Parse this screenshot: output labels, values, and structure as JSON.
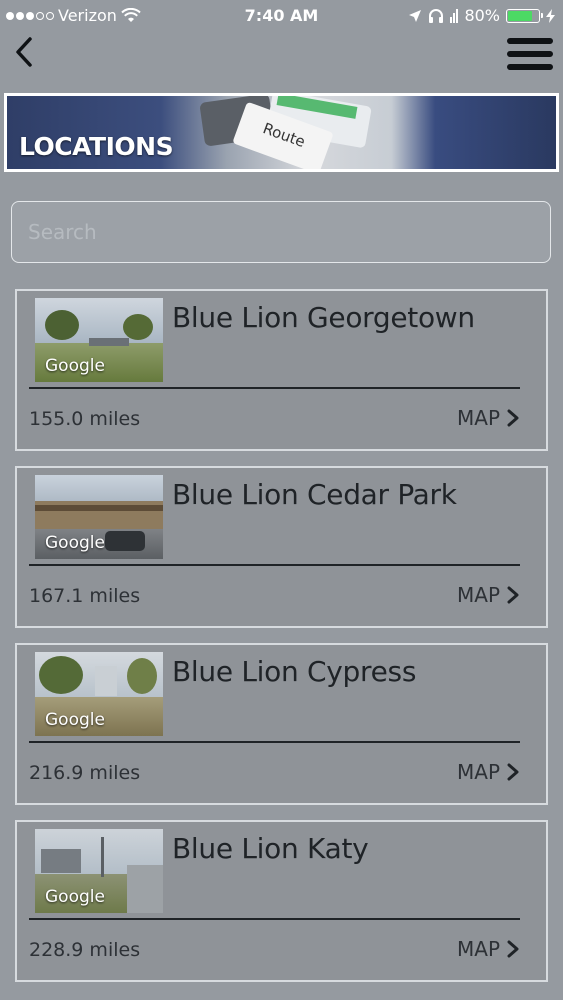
{
  "status_bar": {
    "carrier": "Verizon",
    "time": "7:40 AM",
    "battery": "80%",
    "battery_level": 0.8
  },
  "header": {
    "banner_title": "LOCATIONS",
    "banner_route_text": "Route"
  },
  "search": {
    "placeholder": "Search",
    "value": ""
  },
  "locations": [
    {
      "name": "Blue Lion Georgetown",
      "distance": "155.0 miles",
      "map_label": "MAP",
      "thumb_label": "Google"
    },
    {
      "name": "Blue Lion Cedar Park",
      "distance": "167.1 miles",
      "map_label": "MAP",
      "thumb_label": "Google"
    },
    {
      "name": "Blue Lion Cypress",
      "distance": "216.9 miles",
      "map_label": "MAP",
      "thumb_label": "Google"
    },
    {
      "name": "Blue Lion Katy",
      "distance": "228.9 miles",
      "map_label": "MAP",
      "thumb_label": "Google"
    }
  ],
  "colors": {
    "background": "#959aa0",
    "card_border": "#d7dbdf",
    "battery_green": "#4cd964"
  },
  "icons": {
    "back": "chevron-left-icon",
    "menu": "hamburger-menu-icon",
    "map_arrow": "chevron-right-icon"
  }
}
